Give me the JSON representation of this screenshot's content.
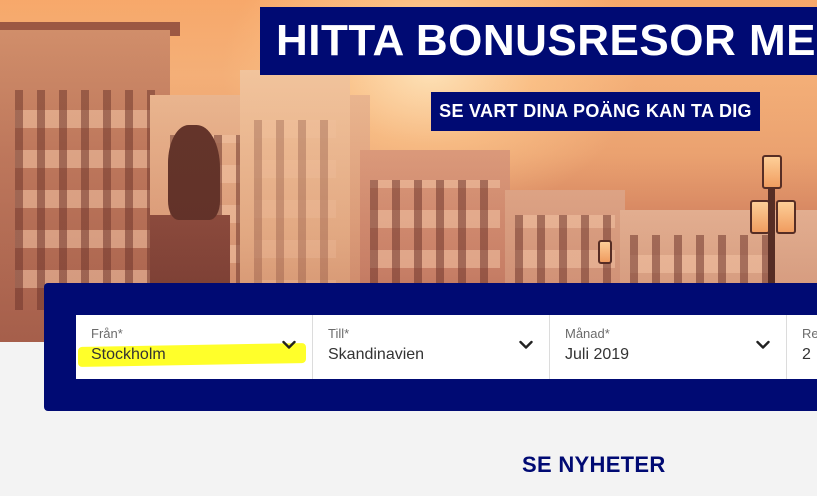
{
  "hero": {
    "headline": "HITTA BONUSRESOR MED",
    "subheadline": "SE VART DINA POÄNG KAN TA DIG"
  },
  "search": {
    "fields": [
      {
        "label": "Från*",
        "value": "Stockholm"
      },
      {
        "label": "Till*",
        "value": "Skandinavien"
      },
      {
        "label": "Månad*",
        "value": "Juli 2019"
      },
      {
        "label": "Re",
        "value": "2"
      }
    ],
    "highlight_color": "#ffff2a"
  },
  "news": {
    "heading": "SE NYHETER"
  },
  "colors": {
    "brand_navy": "#000a73",
    "background": "#f3f3f3"
  },
  "icons": {
    "dropdown": "chevron-down-icon"
  }
}
